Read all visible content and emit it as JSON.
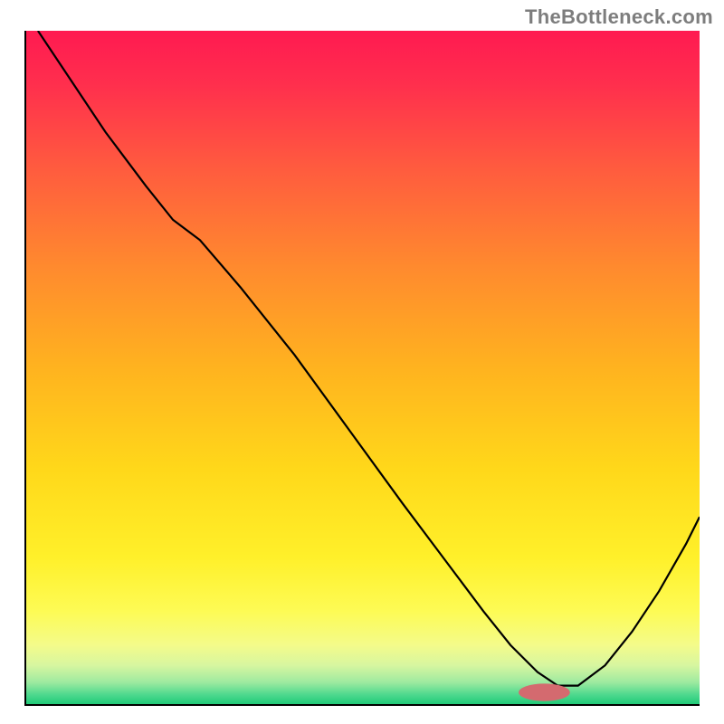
{
  "attribution": "TheBottleneck.com",
  "chart_data": {
    "type": "line",
    "title": "",
    "xlabel": "",
    "ylabel": "",
    "xlim": [
      0,
      100
    ],
    "ylim": [
      0,
      100
    ],
    "series": [
      {
        "name": "curve",
        "x": [
          2,
          6,
          12,
          18,
          22,
          26,
          32,
          40,
          48,
          56,
          62,
          68,
          72,
          76,
          79,
          82,
          86,
          90,
          94,
          98,
          100
        ],
        "y": [
          100,
          94,
          85,
          77,
          72,
          69,
          62,
          52,
          41,
          30,
          22,
          14,
          9,
          5,
          3,
          3,
          6,
          11,
          17,
          24,
          28
        ]
      }
    ],
    "marker": {
      "x": 77,
      "y": 2,
      "rx": 3.8,
      "ry": 1.3,
      "color": "#d46a6f"
    }
  }
}
